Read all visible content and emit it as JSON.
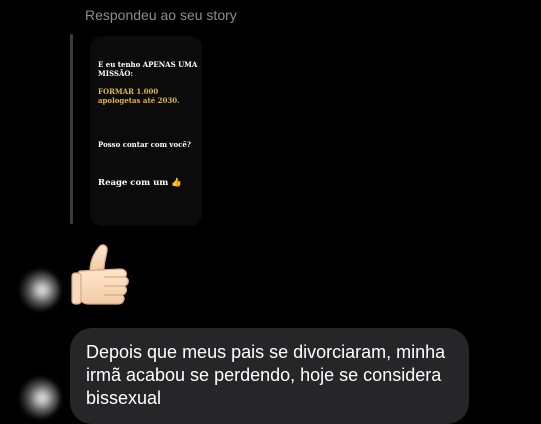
{
  "reply": {
    "label": "Respondeu ao seu story"
  },
  "story": {
    "line1": "E eu tenho APENAS UMA MISSÃO:",
    "line2": "FORMAR 1.000 apologetas até 2030.",
    "line3": "Posso contar com você?",
    "line4": "Reage com um 👍"
  },
  "reaction": {
    "emoji": "👍"
  },
  "message": {
    "text": "Depois que meus pais se divorciaram, minha irmã acabou se perdendo, hoje se considera bissexual"
  },
  "colors": {
    "background": "#000000",
    "bubble": "#262628",
    "accent_yellow": "#e0b64d",
    "muted_text": "#8a8d91"
  }
}
